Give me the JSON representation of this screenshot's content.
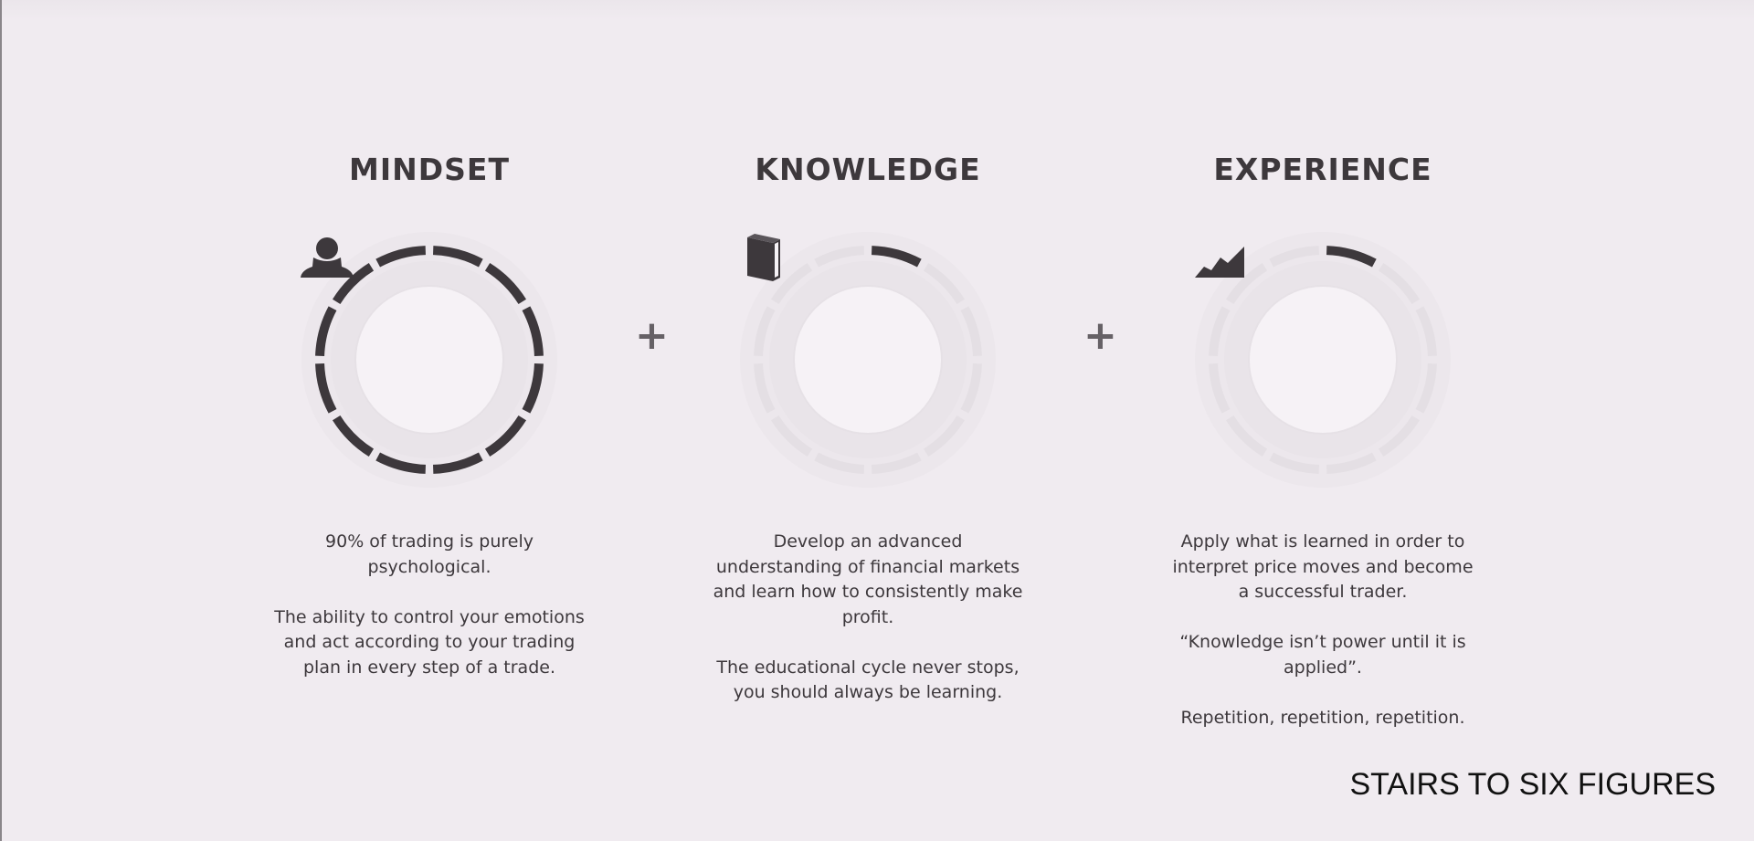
{
  "columns": [
    {
      "title": "MINDSET",
      "icon": "person-icon",
      "progress_segments": 12,
      "paragraphs": [
        "90% of trading is purely psychological.",
        "The ability to control your emotions and act according to your trading plan in every step of a trade."
      ]
    },
    {
      "title": "KNOWLEDGE",
      "icon": "book-icon",
      "progress_segments": 1,
      "paragraphs": [
        "Develop an advanced understanding of financial markets and learn how to consistently make profit.",
        "The educational cycle never stops, you should always be learning."
      ]
    },
    {
      "title": "EXPERIENCE",
      "icon": "chart-icon",
      "progress_segments": 1,
      "paragraphs": [
        "Apply what is learned in order to interpret price moves and become a successful trader.",
        "“Knowledge isn’t power until it is applied”.",
        "Repetition, repetition, repetition."
      ]
    }
  ],
  "operators": [
    "+",
    "+"
  ],
  "brand": "STAIRS TO SIX FIGURES",
  "colors": {
    "accent": "#3d383c",
    "track": "#e4dfe4",
    "background": "#f0ebf0"
  }
}
